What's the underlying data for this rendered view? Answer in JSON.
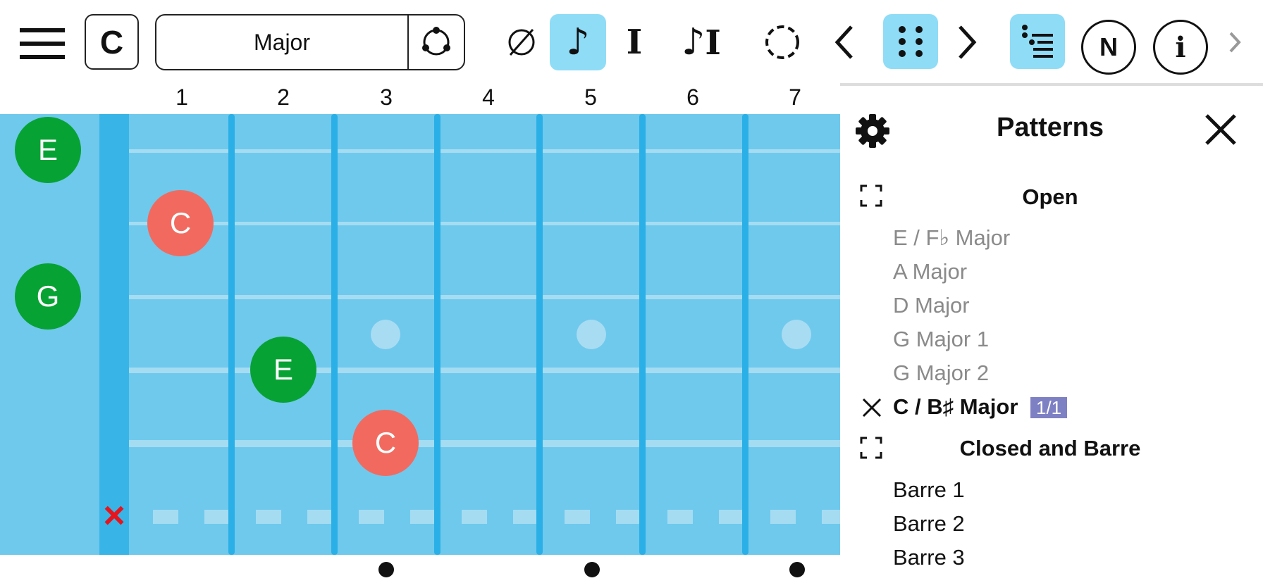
{
  "toolbar": {
    "key_label": "C",
    "scale_name": "Major"
  },
  "fret_numbers": [
    "1",
    "2",
    "3",
    "4",
    "5",
    "6",
    "7"
  ],
  "fretboard": {
    "notes": [
      {
        "label": "E",
        "color": "green"
      },
      {
        "label": "C",
        "color": "red"
      },
      {
        "label": "G",
        "color": "green"
      },
      {
        "label": "E",
        "color": "green"
      },
      {
        "label": "C",
        "color": "red"
      }
    ],
    "muted_string_marker": "×"
  },
  "panel": {
    "title": "Patterns",
    "sections": [
      {
        "heading": "Open",
        "items": [
          "E / F♭ Major",
          "A Major",
          "D Major",
          "G Major 1",
          "G Major 2",
          "C / B♯ Major"
        ],
        "selected_item": "C / B♯ Major",
        "selected_badge": "1/1"
      },
      {
        "heading": "Closed and Barre",
        "items": [
          "Barre 1",
          "Barre 2",
          "Barre 3"
        ]
      }
    ]
  },
  "colors": {
    "board": "#6fc9ec",
    "fret": "#2ab0e6",
    "green_note": "#07a234",
    "red_note": "#f26a5f",
    "active_button": "#8fdcf6",
    "badge": "#7e80c4"
  },
  "icons": [
    "menu-icon",
    "no-tone-icon",
    "eighth-note-icon",
    "roman-numeral-icon",
    "note-and-numeral-icon",
    "dashed-circle-icon",
    "chevron-left-icon",
    "pattern-grid-icon",
    "chevron-right-icon",
    "list-icon",
    "note-name-icon",
    "info-icon",
    "more-chevron-icon",
    "gear-icon",
    "close-icon",
    "expand-icon"
  ]
}
